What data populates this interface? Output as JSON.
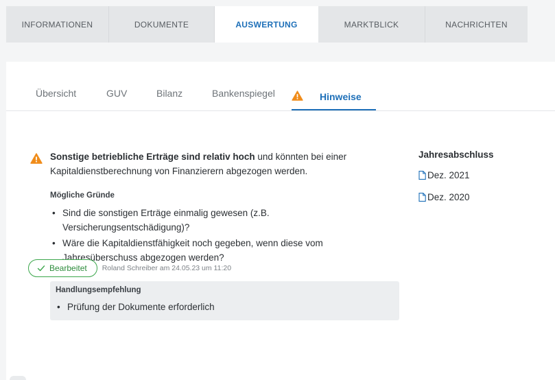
{
  "top_tabs": [
    {
      "label": "INFORMATIONEN"
    },
    {
      "label": "DOKUMENTE"
    },
    {
      "label": "AUSWERTUNG"
    },
    {
      "label": "MARKTBLICK"
    },
    {
      "label": "NACHRICHTEN"
    }
  ],
  "sub_tabs": [
    {
      "label": "Übersicht"
    },
    {
      "label": "GUV"
    },
    {
      "label": "Bilanz"
    },
    {
      "label": "Bankenspiegel"
    },
    {
      "label": "Hinweise"
    }
  ],
  "notice": {
    "headline_bold": "Sonstige betriebliche Erträge sind relativ hoch",
    "headline_rest": " und könnten bei einer Kapitaldienstberechnung von Finanzierern abgezogen werden.",
    "reasons_title": "Mögliche Gründe",
    "reasons": [
      {
        "line1": "Sind die sonstigen Erträge einmalig gewesen (z.B.",
        "line2": "Versicherungsentschädigung)?"
      },
      {
        "line1": "Wäre die Kapitaldienstfähigkeit noch gegeben, wenn diese vom",
        "line2": "Jahresüberschuss abgezogen werden?"
      }
    ],
    "recommendation_title": "Handlungsempfehlung",
    "recommendation_item": "Prüfung der Dokumente erforderlich",
    "status_button": "Bearbeitet",
    "status_meta": "Roland Schreiber am 24.05.23 um 11:20"
  },
  "sidebar": {
    "title": "Jahresabschluss",
    "documents": [
      {
        "label": "Dez. 2021"
      },
      {
        "label": "Dez. 2020"
      }
    ]
  },
  "colors": {
    "accent": "#1d6fb8",
    "warning": "#f08c1a",
    "success": "#3aa64a"
  },
  "icons": {
    "warning": "warning-triangle-icon",
    "check": "check-icon",
    "document": "document-icon"
  }
}
